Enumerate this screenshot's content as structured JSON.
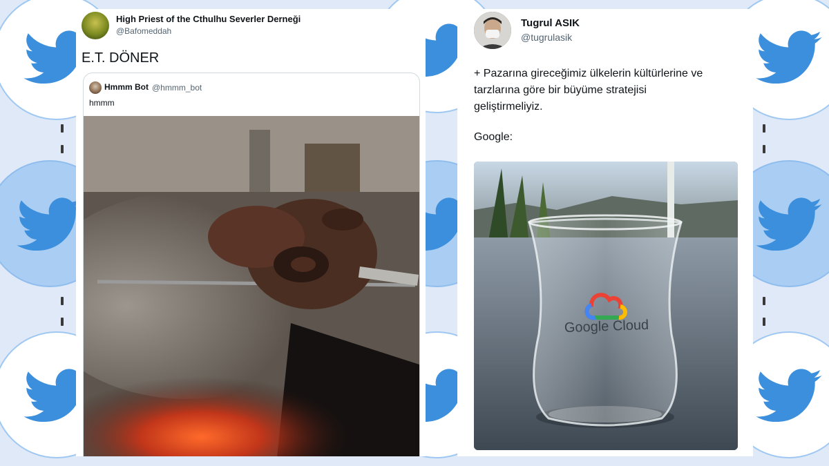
{
  "tweet_left": {
    "author_name": "High Priest of the Cthulhu Severler Derneği",
    "author_handle": "@Bafomeddah",
    "text": "E.T. DÖNER",
    "quoted": {
      "author_name": "Hmmm Bot",
      "author_handle": "@hmmm_bot",
      "text": "hmmm"
    }
  },
  "tweet_right": {
    "author_name": "Tugrul ASIK",
    "author_handle": "@tugrulasik",
    "text_lines": [
      "+ Pazarına gireceğimiz ülkelerin kültürlerine ve",
      "tarzlarına göre bir büyüme stratejisi",
      "geliştirmeliyiz."
    ],
    "text_reply": "Google:",
    "photo_caption": "Google Cloud"
  },
  "colors": {
    "twitter_blue": "#3c8fdc",
    "background": "#dfe9f8"
  },
  "icons": [
    "twitter-bird-icon"
  ]
}
